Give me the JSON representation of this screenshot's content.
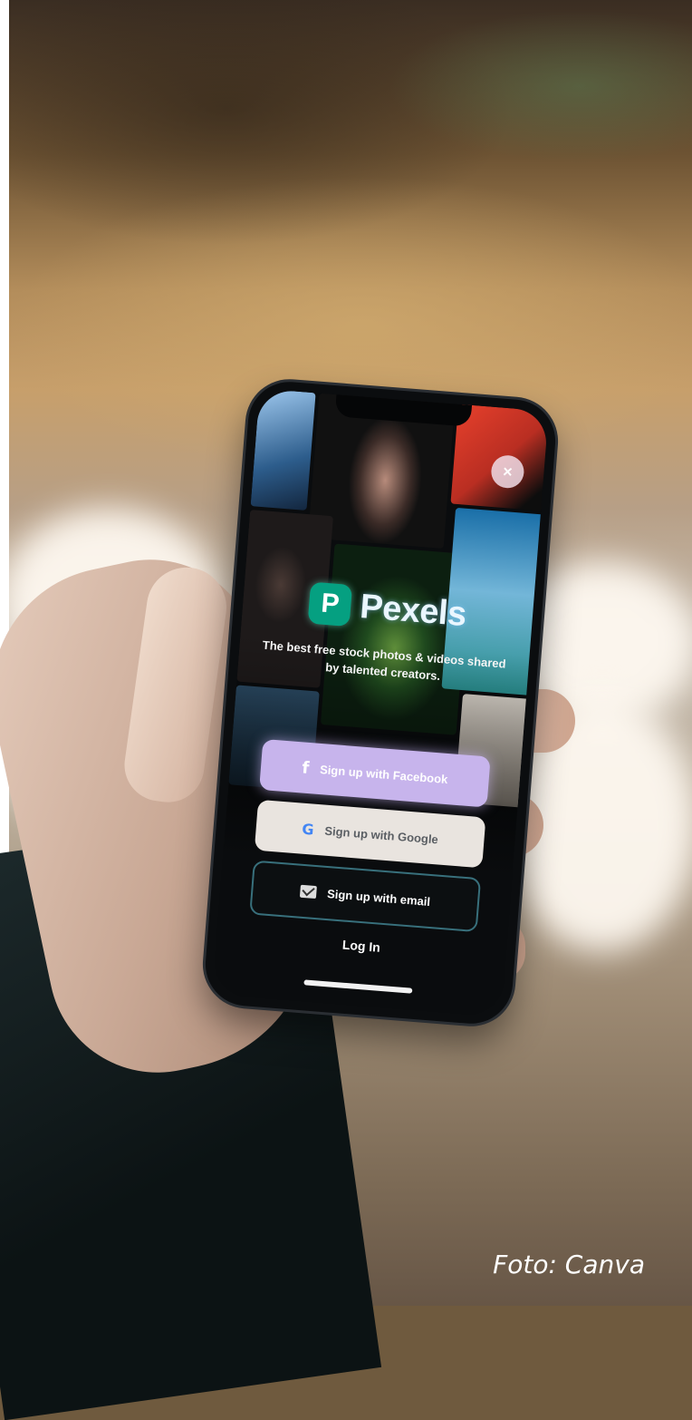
{
  "app": {
    "brand_name": "Pexels",
    "logo_letter": "P",
    "tagline": "The best free stock photos & videos shared by talented creators.",
    "close_symbol": "×"
  },
  "buttons": {
    "facebook": {
      "label": "Sign up with Facebook",
      "icon": "f"
    },
    "google": {
      "label": "Sign up with Google",
      "icon": "G"
    },
    "email": {
      "label": "Sign up with email"
    }
  },
  "login_label": "Log In",
  "caption": "Foto: Canva",
  "colors": {
    "brand_green": "#05a081",
    "facebook_button": "#c7b4ec",
    "google_button": "#e9e4df",
    "email_border": "#38707c"
  }
}
